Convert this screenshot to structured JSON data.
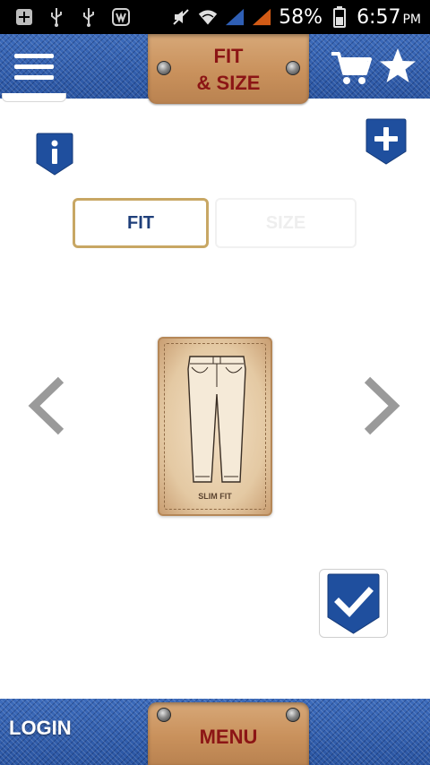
{
  "status_bar": {
    "battery": "58%",
    "time": "6:57",
    "ampm": "PM",
    "icons": [
      "notification-add-icon",
      "usb-icon",
      "usb-icon",
      "app-icon",
      "mute-icon",
      "wifi-icon",
      "signal-icon",
      "signal-icon",
      "battery-icon"
    ]
  },
  "header": {
    "title_line1": "FIT",
    "title_line2": "& SIZE",
    "menu_icon": "hamburger-menu-icon",
    "cart_icon": "cart-icon",
    "favorite_icon": "star-icon"
  },
  "actions": {
    "info_icon": "info-icon",
    "add_icon": "plus-icon"
  },
  "tabs": {
    "fit_label": "FIT",
    "size_label": "SIZE",
    "active": "FIT"
  },
  "carousel": {
    "item_label": "SLIM FIT",
    "prev_icon": "chevron-left-icon",
    "next_icon": "chevron-right-icon"
  },
  "confirm": {
    "icon": "checkmark-icon"
  },
  "footer": {
    "login_label": "LOGIN",
    "menu_label": "MENU"
  },
  "colors": {
    "denim": "#2d5aa8",
    "leather": "#c9915c",
    "leather_text": "#8c1515",
    "accent_blue": "#1f4f9e",
    "fit_border": "#c8a764",
    "arrow_gray": "#9a9a9a"
  }
}
